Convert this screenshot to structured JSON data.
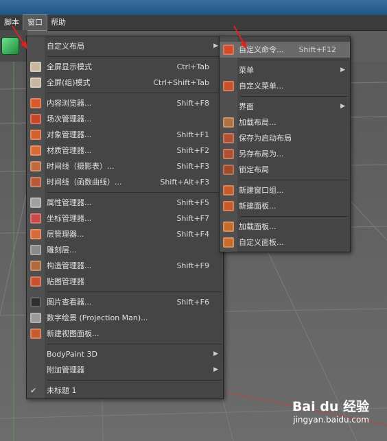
{
  "menubar": {
    "items": [
      "脚本",
      "窗口",
      "帮助"
    ]
  },
  "window_menu": {
    "items": [
      {
        "label": "自定义布局",
        "shortcut": "",
        "arrow": true,
        "icon": "none-icon"
      },
      {
        "sep": true
      },
      {
        "label": "全屏显示模式",
        "shortcut": "Ctrl+Tab",
        "icon": "fullscreen-icon"
      },
      {
        "label": "全屏(组)模式",
        "shortcut": "Ctrl+Shift+Tab",
        "icon": "fullscreen-group-icon"
      },
      {
        "sep": true
      },
      {
        "label": "内容浏览器...",
        "shortcut": "Shift+F8",
        "icon": "content-browser-icon"
      },
      {
        "label": "场次管理器...",
        "shortcut": "",
        "icon": "take-manager-icon"
      },
      {
        "label": "对象管理器...",
        "shortcut": "Shift+F1",
        "icon": "object-manager-icon"
      },
      {
        "label": "材质管理器...",
        "shortcut": "Shift+F2",
        "icon": "material-manager-icon"
      },
      {
        "label": "时间线（摄影表）...",
        "shortcut": "Shift+F3",
        "icon": "timeline-icon"
      },
      {
        "label": "时间线（函数曲线）...",
        "shortcut": "Shift+Alt+F3",
        "icon": "fcurve-icon"
      },
      {
        "sep": true
      },
      {
        "label": "属性管理器...",
        "shortcut": "Shift+F5",
        "icon": "attribute-manager-icon"
      },
      {
        "label": "坐标管理器...",
        "shortcut": "Shift+F7",
        "icon": "coordinate-manager-icon"
      },
      {
        "label": "层管理器...",
        "shortcut": "Shift+F4",
        "icon": "layer-manager-icon"
      },
      {
        "label": "雕刻层...",
        "shortcut": "",
        "icon": "sculpt-layer-icon"
      },
      {
        "label": "构造管理器...",
        "shortcut": "Shift+F9",
        "icon": "structure-manager-icon"
      },
      {
        "label": "贴图管理器",
        "shortcut": "",
        "icon": "texture-manager-icon"
      },
      {
        "sep": true
      },
      {
        "label": "图片查看器...",
        "shortcut": "Shift+F6",
        "icon": "picture-viewer-icon"
      },
      {
        "label": "数字绘景 (Projection Man)...",
        "shortcut": "",
        "icon": "projection-man-icon"
      },
      {
        "label": "新建视图面板...",
        "shortcut": "",
        "icon": "new-view-panel-icon"
      },
      {
        "sep": true
      },
      {
        "label": "BodyPaint 3D",
        "shortcut": "",
        "arrow": true,
        "icon": "none-icon"
      },
      {
        "label": "附加管理器",
        "shortcut": "",
        "arrow": true,
        "icon": "none-icon"
      },
      {
        "sep": true
      },
      {
        "label": "未标题 1",
        "shortcut": "",
        "icon": "check-icon"
      }
    ]
  },
  "custom_layout_menu": {
    "items": [
      {
        "label": "自定义命令...",
        "shortcut": "Shift+F12",
        "icon": "customize-commands-icon",
        "highlight": true
      },
      {
        "sep": true
      },
      {
        "label": "菜单",
        "arrow": true,
        "icon": "none-icon"
      },
      {
        "label": "自定义菜单...",
        "icon": "custom-menu-icon"
      },
      {
        "sep": true
      },
      {
        "label": "界面",
        "arrow": true,
        "icon": "none-icon"
      },
      {
        "label": "加载布局...",
        "icon": "load-layout-icon"
      },
      {
        "label": "保存为启动布局",
        "icon": "save-startup-layout-icon"
      },
      {
        "label": "另存布局为...",
        "icon": "save-layout-as-icon"
      },
      {
        "label": "锁定布局",
        "icon": "lock-layout-icon"
      },
      {
        "sep": true
      },
      {
        "label": "新建窗口组...",
        "icon": "new-window-group-icon"
      },
      {
        "label": "新建面板...",
        "icon": "new-panel-icon"
      },
      {
        "sep": true
      },
      {
        "label": "加载面板...",
        "icon": "load-panel-icon"
      },
      {
        "label": "自定义面板...",
        "icon": "custom-panel-icon"
      }
    ]
  },
  "watermark": {
    "logo": "Bai du 经验",
    "url": "jingyan.baidu.com"
  },
  "colors": {
    "menu_bg": "#454545",
    "highlight": "#6a6a6a",
    "annotation_red": "#e0201e"
  }
}
